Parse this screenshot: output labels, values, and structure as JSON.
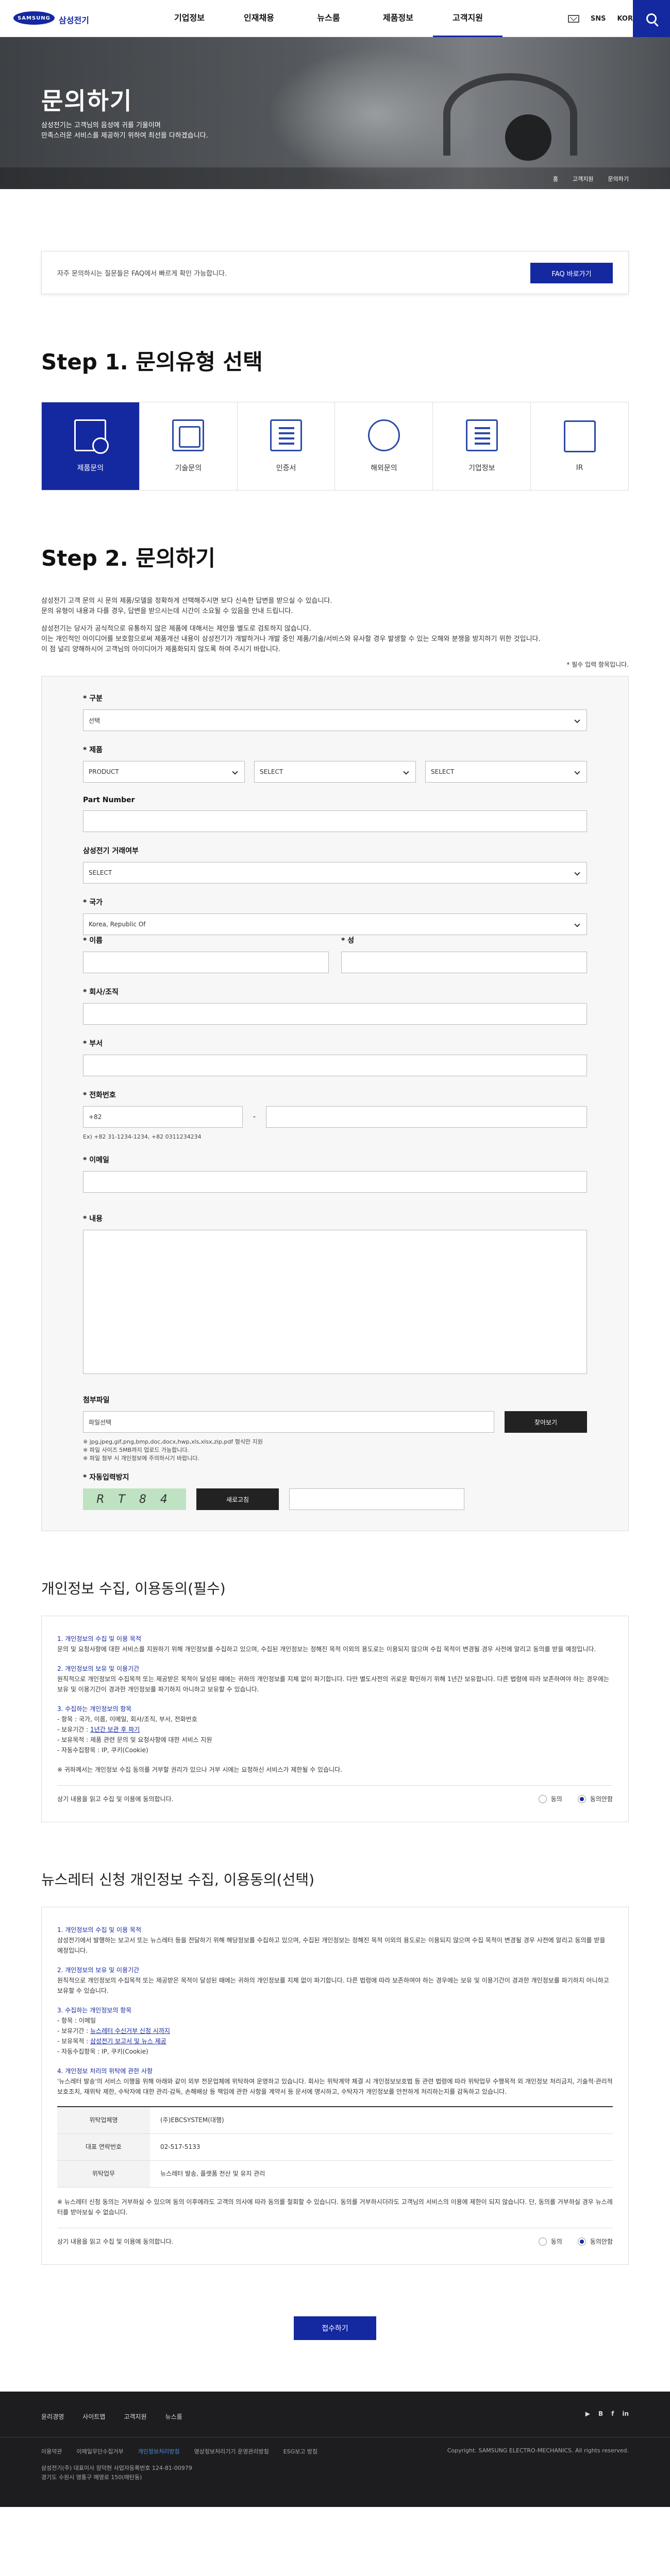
{
  "header": {
    "logo": "SAMSUNG",
    "brand": "삼성전기",
    "nav": [
      "기업정보",
      "인재채용",
      "뉴스룸",
      "제품정보",
      "고객지원"
    ],
    "active": "고객지원",
    "util": [
      "SNS",
      "KOR"
    ]
  },
  "hero": {
    "title": "문의하기",
    "desc1": "삼성전기는 고객님의 음성에 귀를 기울이며",
    "desc2": "만족스러운 서비스를 제공하기 위하여 최선을 다하겠습니다.",
    "crumbs": [
      "홈",
      "고객지원",
      "문의하기"
    ]
  },
  "faq": {
    "text": "자주 문의하시는 질문들은 FAQ에서 빠르게 확인 가능합니다.",
    "button": "FAQ 바로가기"
  },
  "step1": {
    "title": "Step 1. 문의유형 선택",
    "types": [
      "제품문의",
      "기술문의",
      "인증서",
      "해외문의",
      "기업정보",
      "IR"
    ]
  },
  "step2": {
    "title": "Step 2. 문의하기",
    "intro": [
      "삼성전기 고객 문의 시 문의 제품/모델을 정확하게 선택해주시면 보다 신속한 답변을 받으실 수 있습니다.",
      "문의 유형이 내용과 다를 경우, 답변을 받으시는데 시간이 소요될 수 있음을 안내 드립니다.",
      "",
      "삼성전기는 당사가 공식적으로 유통하지 않은 제품에 대해서는 제안을 별도로 검토하지 않습니다.",
      "이는 개인적인 아이디어를 보호함으로써 제품개선 내용이 삼성전기가 개발하거나 개발 중인 제품/기술/서비스와 유사할 경우 발생할 수 있는 오해와 분쟁을 방지하기 위한 것입니다.",
      "이 점 널리 양해하시어 고객님의 아이디어가 제품화되지 않도록 하여 주시기 바랍니다."
    ],
    "required_note": "* 필수 입력 항목입니다.",
    "labels": {
      "type": "* 구분",
      "product": "* 제품",
      "part": "Part Number",
      "trader": "삼성전기 거래여부",
      "country": "* 국가",
      "name": "* 이름",
      "surname": "* 성",
      "company": "* 회사/조직",
      "dept": "* 부서",
      "phone": "* 전화번호",
      "email": "* 이메일",
      "content": "* 내용",
      "file": "첨부파일",
      "captcha": "* 자동입력방지"
    },
    "values": {
      "type": "선택",
      "product": [
        "PRODUCT",
        "SELECT",
        "SELECT"
      ],
      "trader": "SELECT",
      "country": "Korea, Republic Of",
      "phone_code": "+82",
      "file_placeholder": "파일선택"
    },
    "phone_hint": "Ex) +82 31-1234-1234, +82 0311234234",
    "file_hints": [
      "※ jpg,jpeg,gif,png,bmp,doc,docx,hwp,xls,xlsx,zip,pdf 형식만 지원",
      "※ 파일 사이즈 5MB까지 업로드 가능합니다.",
      "※ 파일 첨부 시 개인정보에 주의하시기 바랍니다."
    ],
    "file_button": "찾아보기",
    "captcha_text": "R T 8 4",
    "refresh": "새로고침"
  },
  "privacy": {
    "title": "개인정보 수집, 이용동의(필수)",
    "sections": [
      {
        "h": "1. 개인정보의 수집 및 이용 목적",
        "t": "문의 및 요청사항에 대한 서비스를 지원하기 위해 개인정보를 수집하고 있으며, 수집된 개인정보는 정해진 목적 이외의 용도로는 이용되지 않으며 수집 목적이 변경될 경우 사전에 알리고 동의를 받을 예정입니다."
      },
      {
        "h": "2. 개인정보의 보유 및 이용기간",
        "t": "원칙적으로 개인정보의 수집목적 또는 제공받은 목적이 달성된 때에는 귀하의 개인정보를 지체 없이 파기합니다. 다만 별도사전의 귀로운 확인하기 위해 1년간 보유합니다. 다른 법령에 따라 보존하여야 하는 경우에는 보유 및 이용기간이 경과한 개인정보를 파기하지 아니하고 보유할 수 있습니다."
      },
      {
        "h": "3. 수집하는 개인정보의 항목",
        "t": ""
      }
    ],
    "items": [
      "- 항목 : 국가, 이름, 이메일, 회사/조직, 부서, 전화번호",
      "- 보유기간 : ",
      "- 보유목적 : 제품 관련 문의 및 요청사항에 대한 서비스 지원",
      "- 자동수집항목 : IP, 쿠키(Cookie)"
    ],
    "link": "1년간 보관 후 파기",
    "note": "※ 귀하께서는 개인정보 수집 동의를 거부할 권리가 있으나 거부 시에는 요청하신 서비스가 제한될 수 있습니다.",
    "question": "상기 내용을 읽고 수집 및 이용에 동의합니다.",
    "radios": [
      "동의",
      "동의안함"
    ]
  },
  "newsletter": {
    "title": "뉴스레터 신청 개인정보 수집, 이용동의(선택)",
    "s1h": "1. 개인정보의 수집 및 이용 목적",
    "s1t": "삼성전기에서 발행하는 보고서 또는 뉴스레터 등을 전달하기 위해 해당정보를 수집하고 있으며, 수집된 개인정보는 정해진 목적 이외의 용도로는 이용되지 않으며 수집 목적이 변경될 경우 사전에 알리고 동의를 받을 예정입니다.",
    "s2h": "2. 개인정보의 보유 및 이용기간",
    "s2t": "원칙적으로 개인정보의 수집목적 또는 제공받은 목적이 달성된 때에는 귀하의 개인정보를 지체 없이 파기합니다. 다른 법령에 따라 보존하여야 하는 경우에는 보유 및 이용기간이 경과한 개인정보를 파기하지 아니하고 보유할 수 있습니다.",
    "s3h": "3. 수집하는 개인정보의 항목",
    "s3a": "- 항목 : 이메일",
    "s3b": "- 보유기간 : ",
    "s3bl": "뉴스레터 수신거부 신청 시까지",
    "s3c": "- 보유목적 : ",
    "s3cl": "삼성전기 보고서 및 뉴스 제공",
    "s3d": "- 자동수집항목 : IP, 쿠키(Cookie)",
    "s4h": "4. 개인정보 처리의 위탁에 관한 사항",
    "s4t": "'뉴스레터 발송'의 서비스 이행을 위해 아래와 같이 외부 전문업체에 위탁하여 운영하고 있습니다. 회사는 위탁계약 체결 시 개인정보보호법 등 관련 법령에 따라 위탁업무 수행목적 외 개인정보 처리금지, 기술적·관리적 보호조치, 재위탁 제한, 수탁자에 대한 관리·감독, 손해배상 등 책임에 관한 사항을 계약서 등 문서에 명시하고, 수탁자가 개인정보를 안전하게 처리하는지를 감독하고 있습니다.",
    "table": [
      [
        "위탁업체명",
        "(주)EBCSYSTEM(대행)"
      ],
      [
        "대표 연락번호",
        "02-517-5133"
      ],
      [
        "위탁업무",
        "뉴스레터 발송, 플랫폼 전산 및 유지 관리"
      ]
    ],
    "note": "※ 뉴스레터 신청 동의는 거부하실 수 있으며 동의 이후에라도 고객의 의사에 따라 동의를 철회할 수 있습니다. 동의를 거부하시더라도 고객님의 서비스의 이용에 제한이 되지 않습니다. 단, 동의를 거부하실 경우 뉴스레터를 받아보실 수 없습니다.",
    "question": "상기 내용을 읽고 수집 및 이용에 동의합니다.",
    "radios": [
      "동의",
      "동의안함"
    ]
  },
  "submit": "접수하기",
  "footer": {
    "links": [
      "윤리경영",
      "사이트맵",
      "고객지원",
      "뉴스룸"
    ],
    "sns": [
      "▶",
      "B",
      "f",
      "in"
    ],
    "links2": [
      "이용약관",
      "이메일무단수집거부",
      "개인정보처리방침",
      "영상정보처리기기 운영관리방침",
      "ESG보고 방침"
    ],
    "addr1": "삼성전기(주)  대표이사 장덕현  사업자등록번호 124-81-00979",
    "addr2": "경기도 수원시 영통구 매영로 150(매탄동)",
    "copy": "Copyright. SAMSUNG ELECTRO-MECHANICS. All rights reserved."
  }
}
